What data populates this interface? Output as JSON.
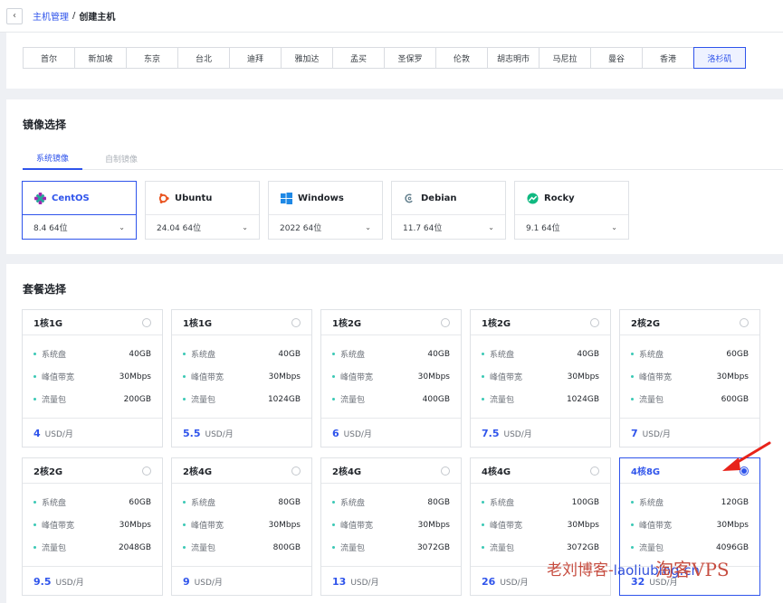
{
  "header": {
    "back_icon": "chevron-left-icon",
    "crumb_parent": "主机管理",
    "crumb_sep": "/",
    "crumb_current": "创建主机"
  },
  "regions": {
    "items": [
      "首尔",
      "新加坡",
      "东京",
      "台北",
      "迪拜",
      "雅加达",
      "孟买",
      "圣保罗",
      "伦敦",
      "胡志明市",
      "马尼拉",
      "曼谷",
      "香港",
      "洛杉矶"
    ],
    "selected": "洛杉矶"
  },
  "image": {
    "title": "镜像选择",
    "tabs": [
      {
        "label": "系统镜像",
        "active": true
      },
      {
        "label": "自制镜像",
        "active": false
      }
    ],
    "os": [
      {
        "name": "CentOS",
        "version": "8.4 64位",
        "icon": "centos-icon",
        "active": true
      },
      {
        "name": "Ubuntu",
        "version": "24.04 64位",
        "icon": "ubuntu-icon",
        "active": false
      },
      {
        "name": "Windows",
        "version": "2022 64位",
        "icon": "windows-icon",
        "active": false
      },
      {
        "name": "Debian",
        "version": "11.7 64位",
        "icon": "debian-icon",
        "active": false
      },
      {
        "name": "Rocky",
        "version": "9.1 64位",
        "icon": "rocky-icon",
        "active": false
      }
    ]
  },
  "plans": {
    "title": "套餐选择",
    "spec_labels": {
      "disk": "系统盘",
      "bandwidth": "峰值带宽",
      "traffic": "流量包"
    },
    "price_unit": "USD/月",
    "items": [
      {
        "name": "1核1G",
        "disk": "40GB",
        "bandwidth": "30Mbps",
        "traffic": "200GB",
        "price": "4",
        "selected": false
      },
      {
        "name": "1核1G",
        "disk": "40GB",
        "bandwidth": "30Mbps",
        "traffic": "1024GB",
        "price": "5.5",
        "selected": false
      },
      {
        "name": "1核2G",
        "disk": "40GB",
        "bandwidth": "30Mbps",
        "traffic": "400GB",
        "price": "6",
        "selected": false
      },
      {
        "name": "1核2G",
        "disk": "40GB",
        "bandwidth": "30Mbps",
        "traffic": "1024GB",
        "price": "7.5",
        "selected": false
      },
      {
        "name": "2核2G",
        "disk": "60GB",
        "bandwidth": "30Mbps",
        "traffic": "600GB",
        "price": "7",
        "selected": false
      },
      {
        "name": "2核2G",
        "disk": "60GB",
        "bandwidth": "30Mbps",
        "traffic": "2048GB",
        "price": "9.5",
        "selected": false
      },
      {
        "name": "2核4G",
        "disk": "80GB",
        "bandwidth": "30Mbps",
        "traffic": "800GB",
        "price": "9",
        "selected": false
      },
      {
        "name": "2核4G",
        "disk": "80GB",
        "bandwidth": "30Mbps",
        "traffic": "3072GB",
        "price": "13",
        "selected": false
      },
      {
        "name": "4核4G",
        "disk": "100GB",
        "bandwidth": "30Mbps",
        "traffic": "3072GB",
        "price": "26",
        "selected": false
      },
      {
        "name": "4核8G",
        "disk": "120GB",
        "bandwidth": "30Mbps",
        "traffic": "4096GB",
        "price": "32",
        "selected": true
      }
    ]
  },
  "overlay": {
    "watermark_cn": "老刘博客-",
    "watermark_url": "laoliublog.cn",
    "watermark_brand": "淘客VPS",
    "arrow_color": "#e8231a"
  }
}
